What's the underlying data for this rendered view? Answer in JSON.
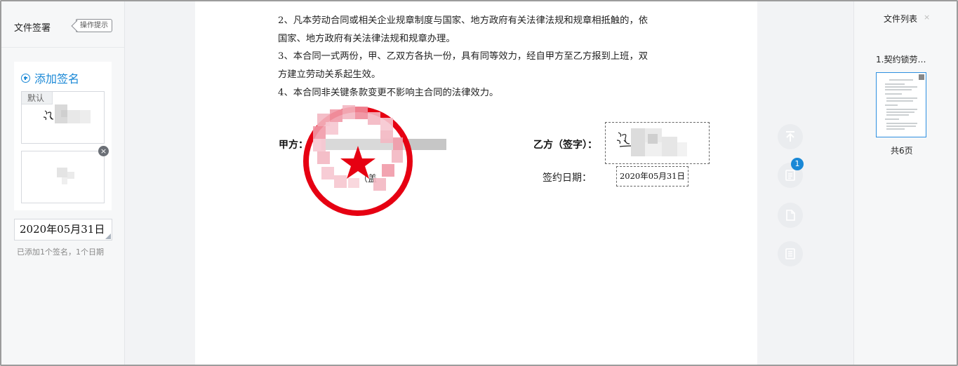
{
  "left_panel": {
    "title": "文件签署",
    "tips_button": "操作提示",
    "add_signature": "添加签名",
    "default_tag": "默认",
    "close_glyph": "×",
    "signature_cards": [
      {
        "label": "signature-card-default"
      },
      {
        "label": "signature-card-2"
      }
    ],
    "date_value": "2020年05月31日",
    "added_note": "已添加1个签名，1个日期"
  },
  "document": {
    "paragraphs": [
      "2、凡本劳动合同或相关企业规章制度与国家、地方政府有关法律法规和规章相抵触的，依",
      "国家、地方政府有关法律法规和规章办理。",
      "3、本合同一式两份，甲、乙双方各执一份，具有同等效力，经自甲方至乙方报到上班，双",
      "方建立劳动关系起生效。",
      "4、本合同非关键条款变更不影响主合同的法律效力。"
    ],
    "party_a_label": "甲方：",
    "stamp_note": "（盖",
    "party_b_label": "乙方（签字）：",
    "sign_date_label": "签约日期：",
    "sign_date_value": "2020年05月31日"
  },
  "tools": {
    "badge_count": "1",
    "icons": [
      "back-to-top-icon",
      "signature-list-icon",
      "document-icon",
      "list-icon"
    ]
  },
  "file_list": {
    "title": "文件列表",
    "close_glyph": "×",
    "file_name": "1.契约锁劳…",
    "page_count": "共6页"
  },
  "colors": {
    "accent": "#1a88d6",
    "stamp_red": "#e60012"
  }
}
